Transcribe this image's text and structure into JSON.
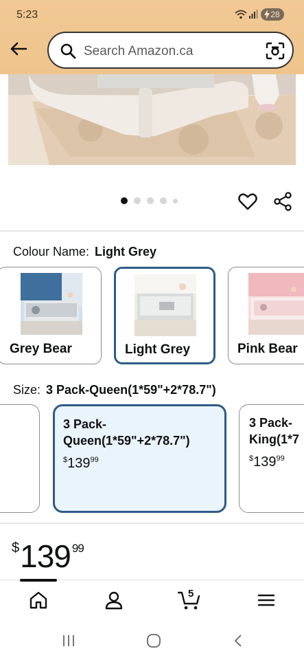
{
  "status_bar": {
    "time": "5:23",
    "battery": "28"
  },
  "search": {
    "placeholder": "Search Amazon.ca"
  },
  "icons": [
    "back-arrow-icon",
    "search-icon",
    "camera-scan-icon",
    "heart-icon",
    "share-icon",
    "home-icon",
    "account-icon",
    "cart-icon",
    "menu-icon"
  ],
  "carousel": {
    "total_dots": 5,
    "active_index": 0
  },
  "colour": {
    "label": "Colour Name:",
    "selected": "Light Grey",
    "options": [
      {
        "name": "Grey Bear"
      },
      {
        "name": "Light Grey"
      },
      {
        "name": "Pink Bear"
      }
    ]
  },
  "size": {
    "label": "Size:",
    "selected": "3 Pack-Queen(1*59\"+2*78.7\")",
    "options": [
      {
        "line1": "3 Pack-",
        "line2": "Queen(1*59\"+2*78.7\")",
        "currency": "$",
        "whole": "139",
        "cents": "99"
      },
      {
        "line1": "3 Pack-",
        "line2": "King(1*7",
        "currency": "$",
        "whole": "139",
        "cents": "99"
      }
    ]
  },
  "price": {
    "currency": "$",
    "whole": "139",
    "cents": "99"
  },
  "bottom_nav": {
    "cart_count": "5"
  },
  "colors": {
    "header": "#efc48c",
    "selected_border": "#2e5b85",
    "selected_fill": "#eaf4fd"
  }
}
